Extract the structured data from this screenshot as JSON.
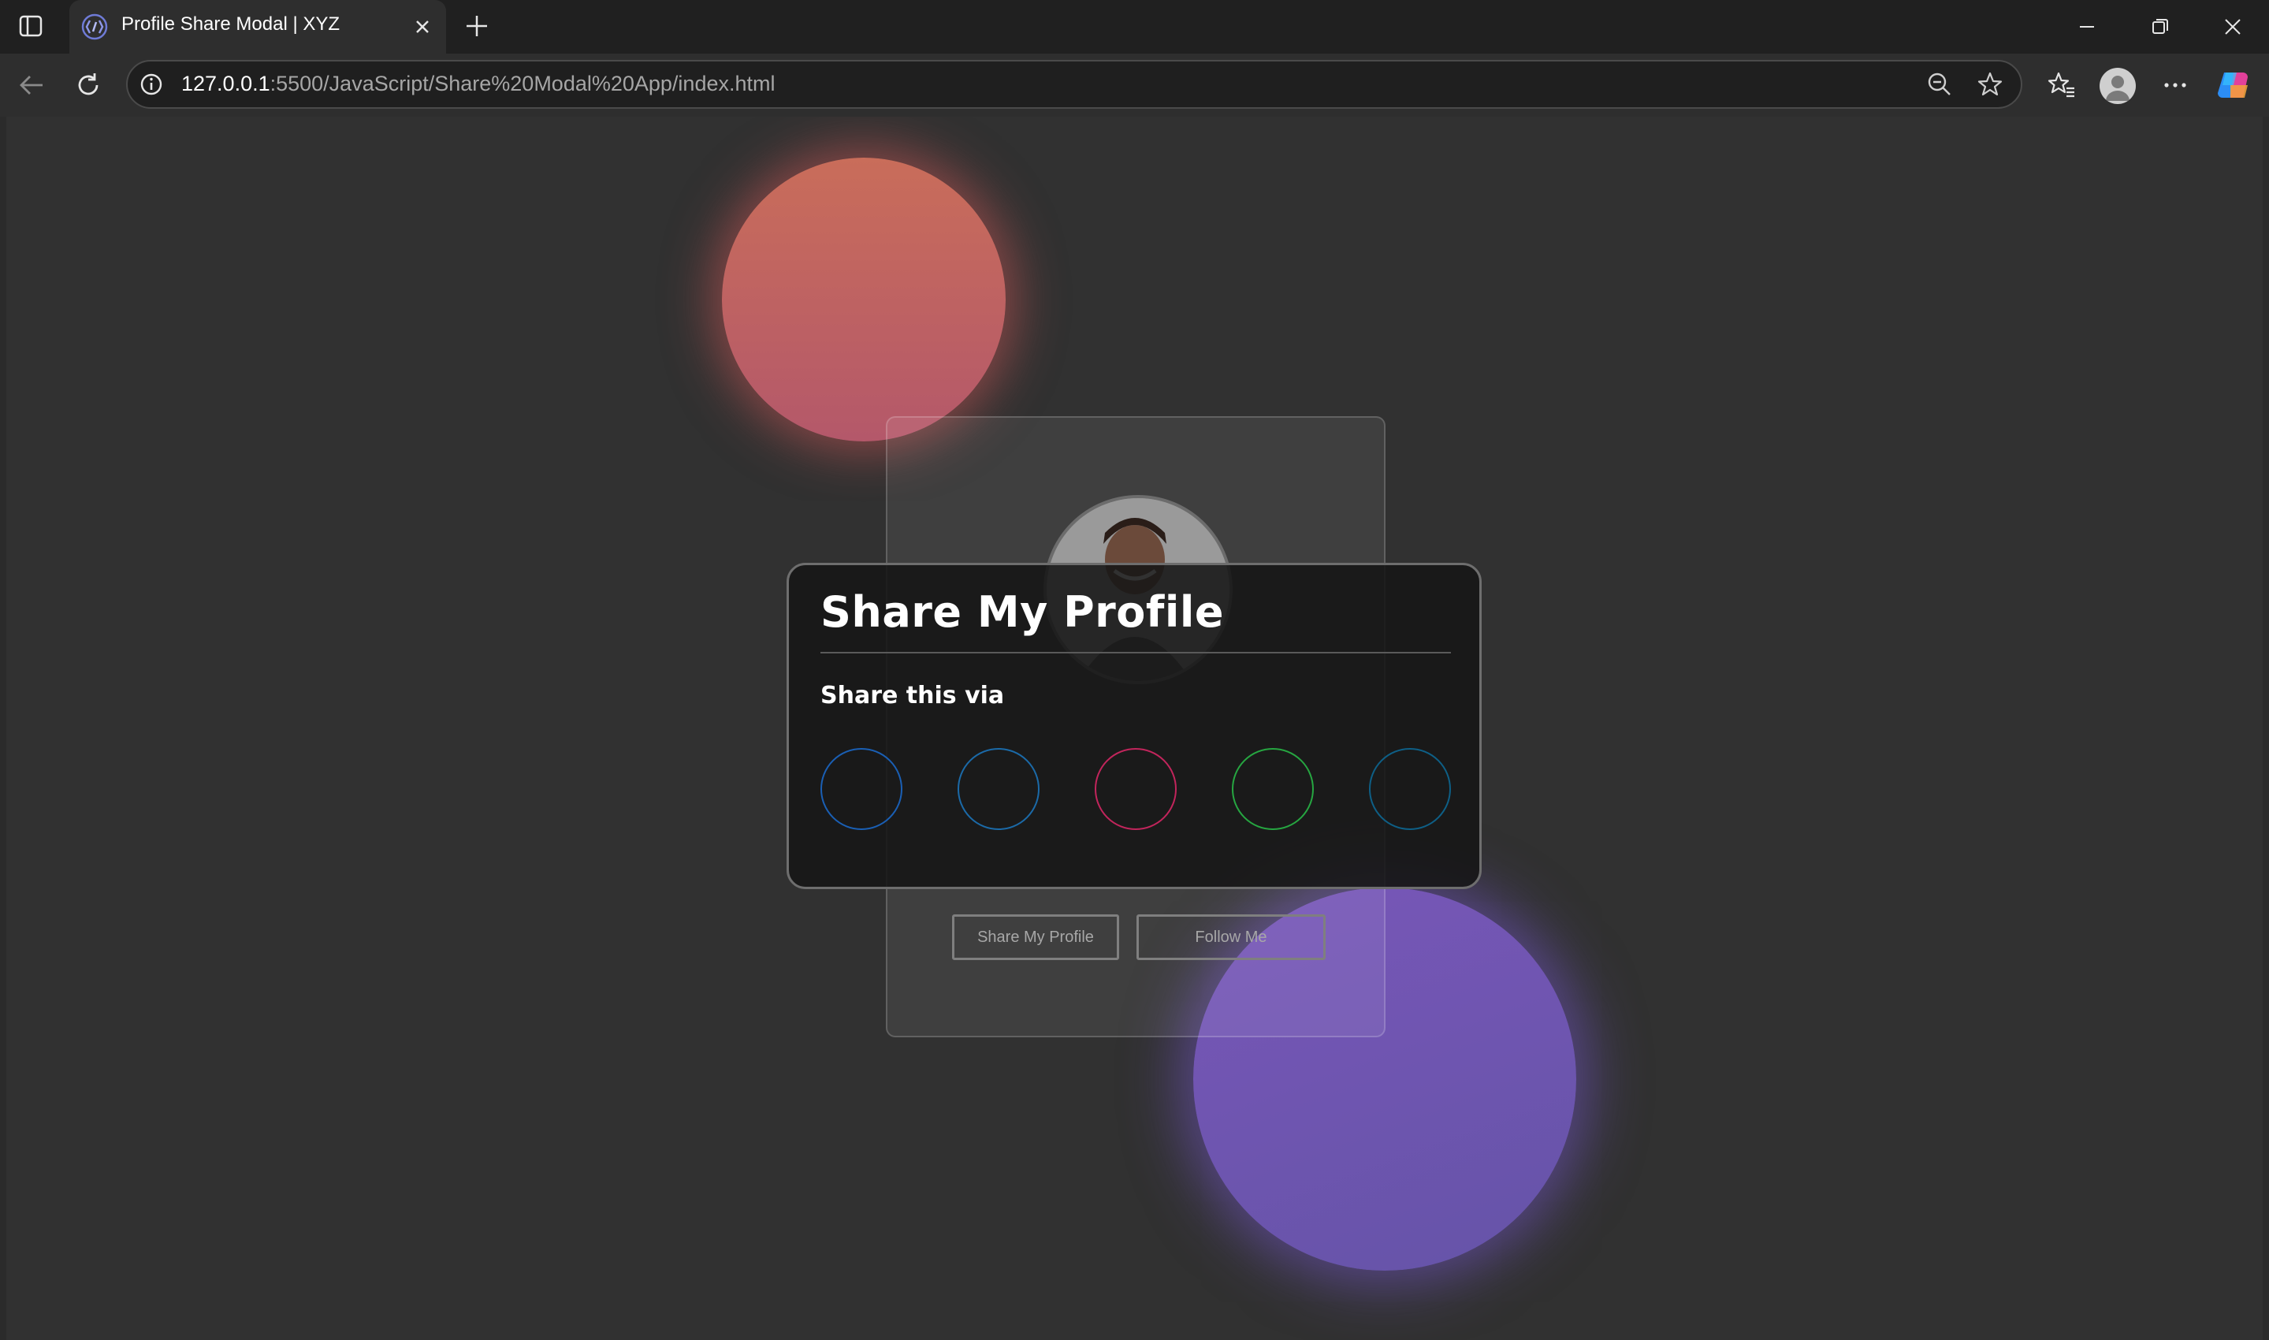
{
  "browser": {
    "tab_title": "Profile Share Modal | XYZ",
    "url_host": "127.0.0.1",
    "url_rest": ":5500/JavaScript/Share%20Modal%20App/index.html"
  },
  "page": {
    "profile_card": {
      "share_button_label": "Share My Profile",
      "follow_button_label": "Follow Me"
    },
    "modal": {
      "title": "Share My Profile",
      "subtitle": "Share this via",
      "share_options": [
        {
          "icon": "facebook-icon",
          "color": "#1a5fb4"
        },
        {
          "icon": "twitter-icon",
          "color": "#1b6aa8"
        },
        {
          "icon": "instagram-icon",
          "color": "#c2255c"
        },
        {
          "icon": "whatsapp-icon",
          "color": "#26a641"
        },
        {
          "icon": "linkedin-icon",
          "color": "#0e5f86"
        }
      ]
    }
  },
  "colors": {
    "blob_orange": "#c96d5a",
    "blob_purple": "#6a52b0",
    "page_background": "#313131"
  }
}
